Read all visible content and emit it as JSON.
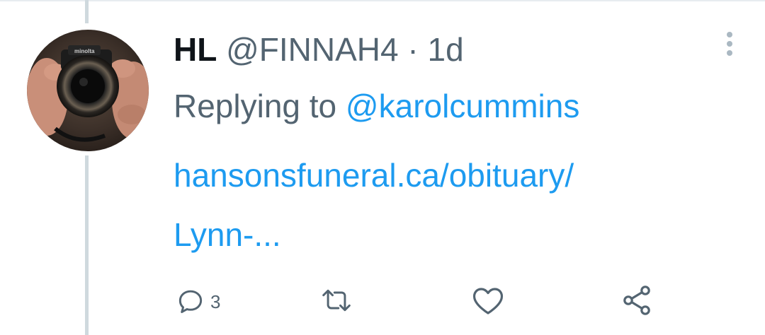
{
  "tweet": {
    "display_name": "HL",
    "handle": "@FINNAH4",
    "separator": "·",
    "time": "1d",
    "replying_prefix": "Replying to",
    "replying_mention": "@karolcummins",
    "link_line_1": "hansonsfuneral.ca/obituary/",
    "link_line_2": "Lynn-..."
  },
  "actions": {
    "reply_count": "3",
    "retweet_count": "",
    "like_count": ""
  },
  "icons": {
    "more": "more-vertical-icon",
    "reply": "comment-bubble-icon",
    "retweet": "retweet-arrows-icon",
    "like": "heart-icon",
    "share": "share-nodes-icon"
  },
  "colors": {
    "accent": "#1d9bf0",
    "secondary_text": "#536471",
    "primary_text": "#0f1419",
    "thread_line": "#cfd9de"
  }
}
